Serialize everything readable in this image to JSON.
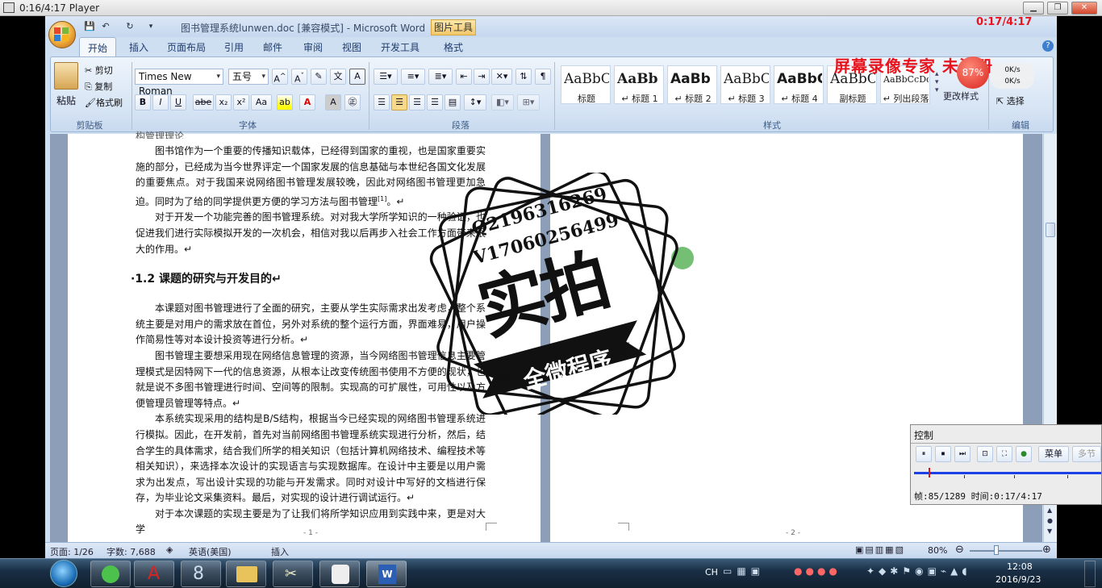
{
  "player": {
    "title": "0:16/4:17 Player",
    "overlay_time": "0:17/4:17"
  },
  "word": {
    "title": "图书管理系统lunwen.doc [兼容模式] - Microsoft Word",
    "context_tab": "图片工具",
    "tabs": [
      "开始",
      "插入",
      "页面布局",
      "引用",
      "邮件",
      "审阅",
      "视图",
      "开发工具",
      "格式"
    ],
    "active_tab": "开始",
    "clipboard": {
      "paste": "粘贴",
      "cut": "剪切",
      "copy": "复制",
      "format_painter": "格式刷",
      "label": "剪贴板"
    },
    "font": {
      "name": "Times New Roman",
      "size": "五号",
      "label": "字体"
    },
    "paragraph": {
      "label": "段落"
    },
    "styles": {
      "label": "样式",
      "items": [
        {
          "preview": "AaBbC",
          "name": "标题"
        },
        {
          "preview": "AaBb",
          "name": "↵ 标题 1"
        },
        {
          "preview": "AaBb",
          "name": "↵ 标题 2"
        },
        {
          "preview": "AaBbC",
          "name": "↵ 标题 3"
        },
        {
          "preview": "AaBbC",
          "name": "↵ 标题 4"
        },
        {
          "preview": "AaBbC",
          "name": "副标题"
        },
        {
          "preview": "AaBbCcDd",
          "name": "↵ 列出段落"
        }
      ],
      "change_styles": "更改样式"
    },
    "editing": {
      "select": "选择",
      "label": "编辑"
    },
    "status": {
      "page": "页面: 1/26",
      "words": "字数: 7,688",
      "language": "英语(美国)",
      "mode": "插入",
      "zoom": "80%"
    }
  },
  "doc": {
    "top_partial": "构管理理论",
    "p1": "图书馆作为一个重要的传播知识载体，已经得到国家的重视，也是国家重要实施的部分，已经成为当今世界评定一个国家发展的信息基础与本世纪各国文化发展的重要焦点。对于我国来说网络图书管理发展较晚，因此对网络图书管理更加急迫。同时为了给的同学提供更方便的学习方法与图书管理",
    "p1_sup": "[1]",
    "p1_end": "。↵",
    "p2": "对于开发一个功能完善的图书管理系统。对对我大学所学知识的一种验证，也促进我们进行实际模拟开发的一次机会，相信对我以后再步入社会工作方面带来很大的作用。↵",
    "heading": "·1.2  课题的研究与开发目的↵",
    "p3": "本课题对图书管理进行了全面的研究，主要从学生实际需求出发考虑，整个系统主要是对用户的需求放在首位，另外对系统的整个运行方面，界面难易，用户操作简易性等对本设计投资等进行分析。↵",
    "p4": "图书管理主要想采用现在网络信息管理的资源，当今网络图书管理信息主要管理模式是因特网下一代的信息资源，从根本让改变传统图书使用不方便的现状，也就是说不多图书管理进行时间、空间等的限制。实现高的可扩展性，可用性以及方便管理员管理等特点。↵",
    "p5": "本系统实现采用的结构是B/S结构，根据当今已经实现的网络图书管理系统进行模拟。因此，在开发前，首先对当前网络图书管理系统实现进行分析，然后，结合学生的具体需求，结合我们所学的相关知识（包括计算机网络技术、编程技术等相关知识），来选择本次设计的实现语言与实现数据库。在设计中主要是以用户需求为出发点，写出设计实现的功能与开发需求。同时对设计中写好的文档进行保存，为毕业论文采集资料。最后，对实现的设计进行调试运行。↵",
    "p6": "对于本次课题的实现主要是为了让我们将所学知识应用到实践中来，更是对大学",
    "page1_num": "- 1 -",
    "page2_num": "- 2 -"
  },
  "watermark": {
    "qq": "Q2196316269",
    "wechat": "V17060256499",
    "big": "实拍",
    "banner": "全微程序"
  },
  "screen_recorder": {
    "text": "屏幕录像专家  未注册",
    "badge": "87%",
    "speed1": "0K/s",
    "speed2": "0K/s"
  },
  "control_panel": {
    "title": "控制",
    "menu": "菜单",
    "multi": "多节",
    "frame": "帧:85/1289 时间:0:17/4:17"
  },
  "taskbar": {
    "lang": "CH",
    "time": "12:08",
    "date": "2016/9/23"
  }
}
